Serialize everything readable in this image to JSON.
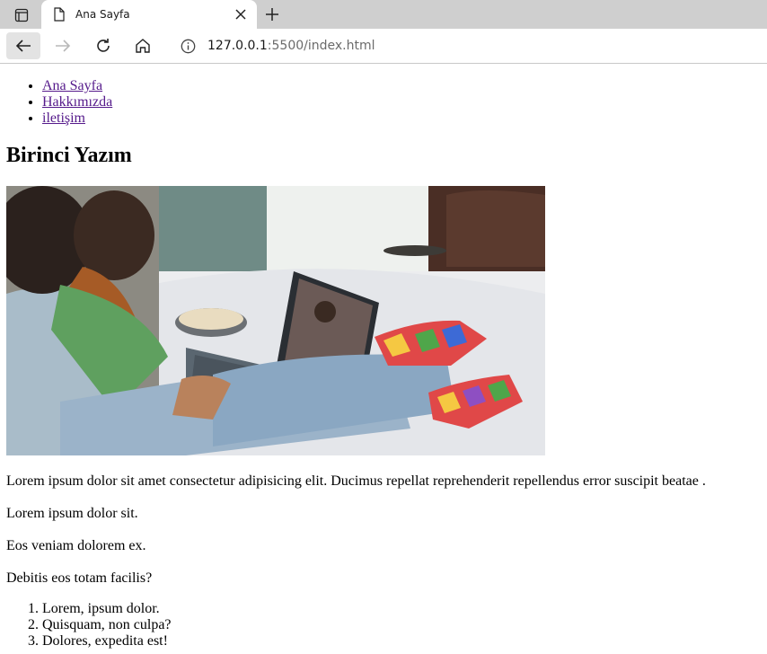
{
  "browser": {
    "tab_title": "Ana Sayfa",
    "url_host": "127.0.0.1",
    "url_path": ":5500/index.html",
    "icons": {
      "tab_actions": "tab-actions-icon",
      "page": "page-icon",
      "close": "close-icon",
      "new_tab": "plus-icon",
      "back": "arrow-left-icon",
      "forward": "arrow-right-icon",
      "reload": "reload-icon",
      "home": "home-icon",
      "site_info": "info-icon"
    }
  },
  "nav": {
    "items": [
      {
        "label": "Ana Sayfa"
      },
      {
        "label": "Hakkımızda"
      },
      {
        "label": "iletişim"
      }
    ]
  },
  "post": {
    "title": "Birinci Yazım",
    "paragraphs": [
      "Lorem ipsum dolor sit amet consectetur adipisicing elit. Ducimus repellat reprehenderit repellendus error suscipit beatae .",
      "Lorem ipsum dolor sit.",
      "Eos veniam dolorem ex.",
      "Debitis eos totam facilis?"
    ],
    "list": [
      "Lorem, ipsum dolor.",
      "Quisquam, non culpa?",
      "Dolores, expedita est!"
    ]
  },
  "colors": {
    "tabbar": "#cfcfcf",
    "link_visited": "#551a8b"
  }
}
